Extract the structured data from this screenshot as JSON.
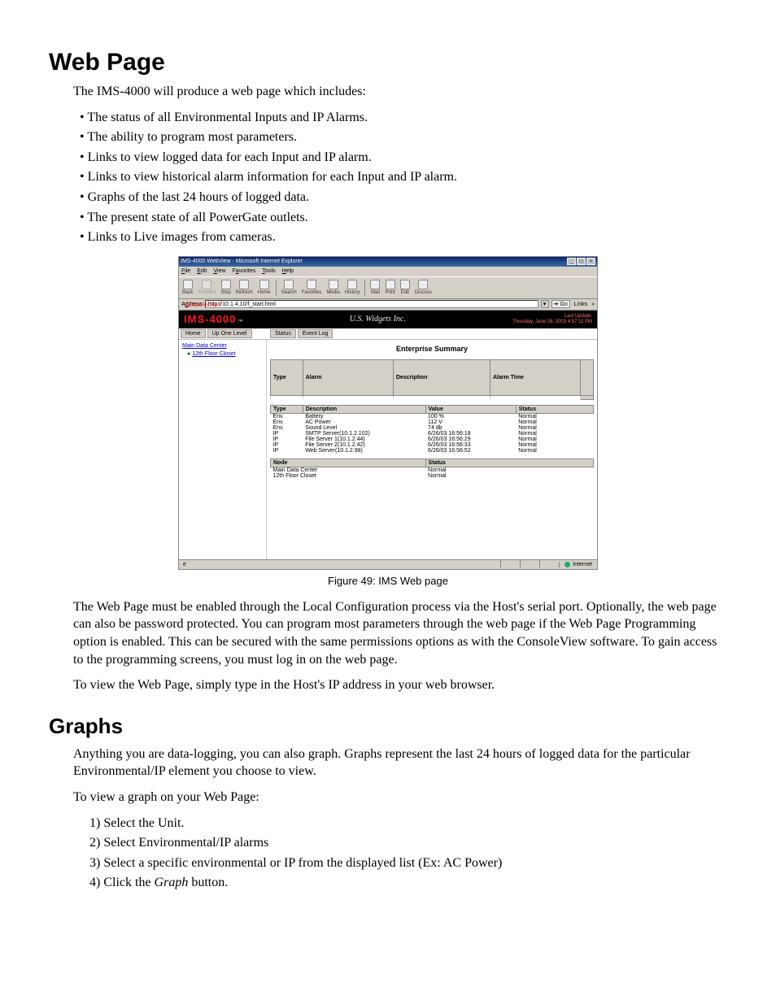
{
  "headings": {
    "webpage": "Web Page",
    "graphs": "Graphs"
  },
  "intro": "The IMS-4000 will produce a web page which includes:",
  "bullets": [
    "The status of all Environmental Inputs and IP Alarms.",
    "The ability to program most parameters.",
    "Links to view logged data for each Input and IP alarm.",
    "Links to view historical alarm information for each Input and IP alarm.",
    "Graphs of the last 24 hours of logged data.",
    "The present state of all PowerGate outlets.",
    "Links to Live images from cameras."
  ],
  "figure_caption": "Figure 49: IMS Web page",
  "after_fig_p1": "The Web Page must be enabled through the Local Configuration process via the Host's serial port. Optionally, the web page can also be password protected. You can program most parameters through the web page if the Web Page Programming option is enabled. This can be secured with the same permissions options as with the ConsoleView software.  To gain access to the programming screens, you must log in on the web page.",
  "after_fig_p2": "To view the Web Page, simply type in the Host's IP address in your web browser.",
  "graphs_p1": "Anything you are data-logging, you can also graph.  Graphs represent the last 24 hours of logged data for the particular Environmental/IP element you choose to view.",
  "graphs_p2": "To view a graph on your Web Page:",
  "steps": [
    "1) Select the Unit.",
    "2) Select Environmental/IP alarms",
    "3) Select a specific environmental or IP from the displayed list (Ex: AC Power)",
    "4) Click the "
  ],
  "step4_italic": "Graph",
  "step4_tail": " button.",
  "browser": {
    "title": "IMS-4000 WebView - Microsoft Internet Explorer",
    "menus": {
      "file": "File",
      "edit": "Edit",
      "view": "View",
      "favorites": "Favorites",
      "tools": "Tools",
      "help": "Help"
    },
    "toolbar": {
      "back": "Back",
      "forward": "Forward",
      "stop": "Stop",
      "refresh": "Refresh",
      "home": "Home",
      "search": "Search",
      "favorites": "Favorites",
      "media": "Media",
      "history": "History",
      "mail": "Mail",
      "print": "Print",
      "edit": "Edit",
      "discuss": "Discuss"
    },
    "address_label": "Address",
    "address_value": "http://10.1.4.10/f_start.html",
    "go": "Go",
    "links": "Links",
    "brand": {
      "sensa": "SENSAPHONE®",
      "ims": "IMS-4000",
      "tm": "™",
      "company": "U.S. Widgets Inc.",
      "last_update_lbl": "Last Update:",
      "last_update_val": "Thursday, June 26, 2003 4:57:11 PM"
    },
    "nav": {
      "home": "Home",
      "up": "Up One Level",
      "status": "Status",
      "eventlog": "Event Log"
    },
    "tree": {
      "root": "Main Data Center",
      "child": "12th Floor Closet"
    },
    "summary_title": "Enterprise Summary",
    "alarm_headers": {
      "type": "Type",
      "alarm": "Alarm",
      "description": "Description",
      "alarm_time": "Alarm Time"
    },
    "env_headers": {
      "type": "Type",
      "description": "Description",
      "value": "Value",
      "status": "Status"
    },
    "env_rows": [
      {
        "type": "Env.",
        "desc": "Battery",
        "value": "100 %",
        "status": "Normal"
      },
      {
        "type": "Env.",
        "desc": "AC Power",
        "value": "112 V",
        "status": "Normal"
      },
      {
        "type": "Env.",
        "desc": "Sound Level",
        "value": "74 db",
        "status": "Normal"
      },
      {
        "type": "IP",
        "desc": "SMTP Server(10.1.2.102)",
        "value": "6/26/03 16:56:18",
        "status": "Normal"
      },
      {
        "type": "IP",
        "desc": "File Server 1(10.1.2.44)",
        "value": "6/26/03 16:56:29",
        "status": "Normal"
      },
      {
        "type": "IP",
        "desc": "File Server 2(10.1.2.42)",
        "value": "6/26/03 16:56:33",
        "status": "Normal"
      },
      {
        "type": "IP",
        "desc": "Web Server(10.1.2.98)",
        "value": "6/26/03 16:56:52",
        "status": "Normal"
      }
    ],
    "node_headers": {
      "node": "Node",
      "status": "Status"
    },
    "node_rows": [
      {
        "node": "Main Data Center",
        "status": "Normal"
      },
      {
        "node": "12th Floor Closet",
        "status": "Normal"
      }
    ],
    "statusbar": {
      "internet": "Internet"
    }
  }
}
